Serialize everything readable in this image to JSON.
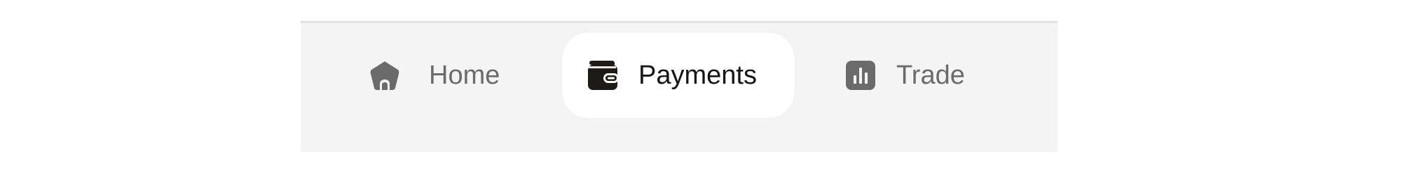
{
  "tabs": [
    {
      "id": "home",
      "label": "Home",
      "icon": "home-icon",
      "active": false
    },
    {
      "id": "payments",
      "label": "Payments",
      "icon": "wallet-icon",
      "active": true
    },
    {
      "id": "trade",
      "label": "Trade",
      "icon": "bar-chart-icon",
      "active": false
    }
  ],
  "colors": {
    "bar_background": "#f4f4f4",
    "active_tab_background": "#ffffff",
    "inactive_text": "#6b6b6b",
    "active_text": "#161616",
    "inactive_icon": "#6b6b6b",
    "active_icon": "#1e1a17"
  }
}
